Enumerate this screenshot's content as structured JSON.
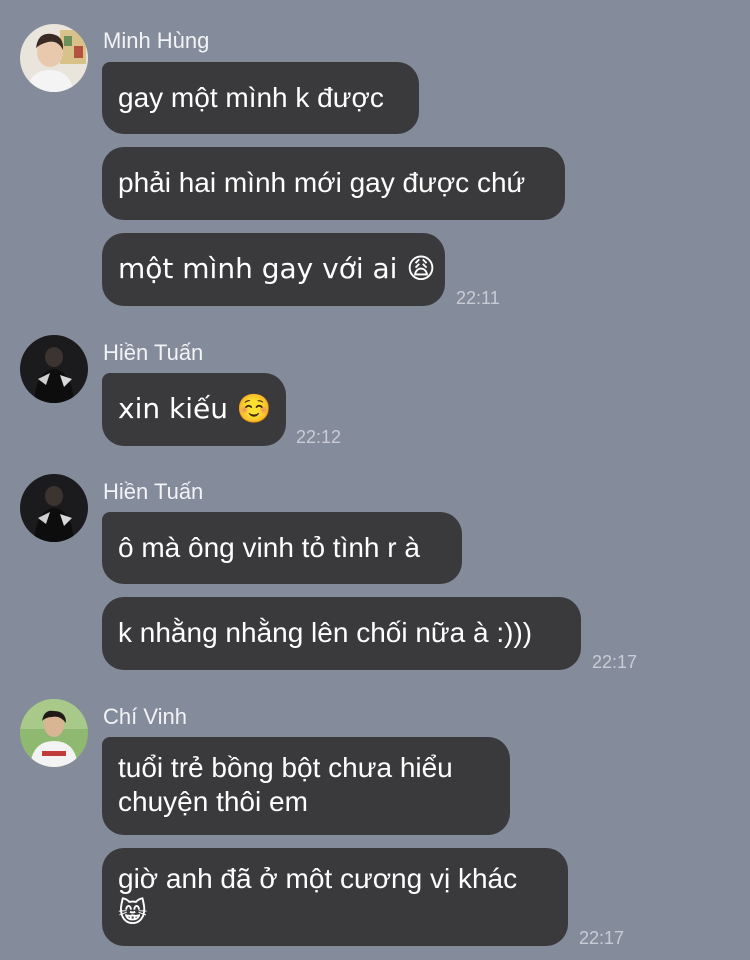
{
  "groups": [
    {
      "sender": "Minh Hùng",
      "avatar_icon": "person-photo-avatar",
      "messages": [
        {
          "text": "gay một mình k được"
        },
        {
          "text": "phải hai mình mới gay được chứ"
        },
        {
          "text": "một mình gay với ai 😩",
          "time": "22:11"
        }
      ]
    },
    {
      "sender": "Hiền Tuấn",
      "avatar_icon": "dark-photo-avatar",
      "messages": [
        {
          "text": "xin kiếu ☺️",
          "time": "22:12"
        }
      ]
    },
    {
      "sender": "Hiền Tuấn",
      "avatar_icon": "dark-photo-avatar",
      "messages": [
        {
          "text": "ô mà ông vinh tỏ tình r à"
        },
        {
          "text": "k nhằng nhằng lên chối nữa à :)))",
          "time": "22:17"
        }
      ]
    },
    {
      "sender": "Chí Vinh",
      "avatar_icon": "person-photo-avatar",
      "messages": [
        {
          "text_line1": "tuổi trẻ bồng bột chưa hiểu",
          "text_line2": "chuyện thôi em"
        },
        {
          "text_line1": "giờ anh đã ở một cương vị khác",
          "text_line2": "😸",
          "time": "22:17"
        }
      ]
    }
  ]
}
